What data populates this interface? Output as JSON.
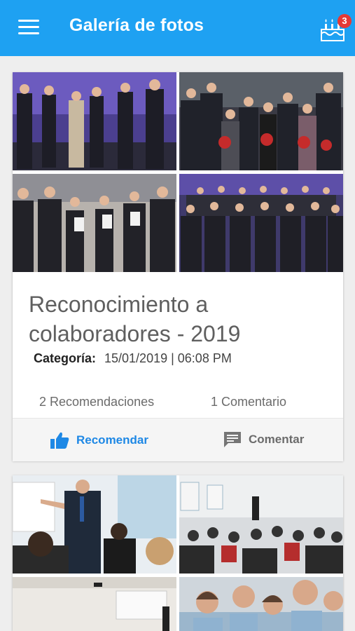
{
  "appbar": {
    "title": "Galería de fotos",
    "menu_icon": "menu-icon",
    "birthday_icon": "birthday-cake-icon",
    "notification_count": "3",
    "color": "#1ea1f2"
  },
  "posts": [
    {
      "title": "Reconocimiento a colaboradores - 2019",
      "category_label": "Categoría:",
      "date": "15/01/2019 | 06:08 PM",
      "recommendations": "2 Recomendaciones",
      "comments": "1 Comentario",
      "recommend_label": "Recomendar",
      "comment_label": "Comentar",
      "recommend_icon": "thumbs-up-icon",
      "comment_icon": "comment-icon",
      "photos": [
        "award-ceremony-group-photo",
        "award-winners-holding-plaques-photo",
        "award-recipients-with-certificates-photo",
        "large-group-stage-photo"
      ]
    },
    {
      "photos": [
        "presenter-at-whiteboard-photo",
        "conference-audience-photo",
        "training-room-photo",
        "smiling-attendees-photo"
      ]
    }
  ],
  "accent_color": "#1e88e5"
}
